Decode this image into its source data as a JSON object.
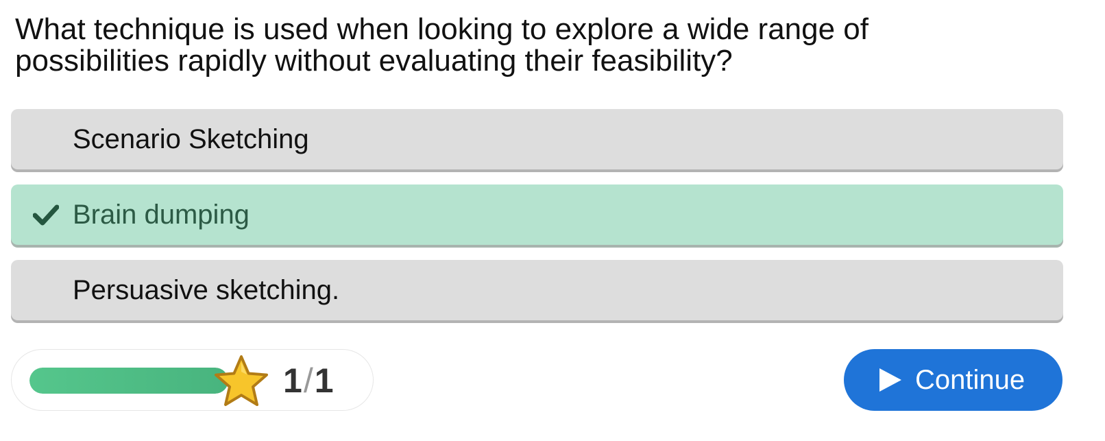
{
  "question": {
    "text": "What technique is used when looking to explore a wide range of possibilities rapidly without evaluating their feasibility?"
  },
  "options": [
    {
      "label": "Scenario Sketching",
      "state": "neutral"
    },
    {
      "label": "Brain dumping",
      "state": "correct",
      "icon": "check-icon"
    },
    {
      "label": "Persuasive sketching.",
      "state": "neutral"
    }
  ],
  "progress": {
    "fraction": 1.0,
    "current": "1",
    "separator": "/",
    "total": "1",
    "icon": "star-icon"
  },
  "continue_button": {
    "label": "Continue",
    "icon": "play-icon"
  },
  "colors": {
    "correct_bg": "#b5e3cf",
    "neutral_bg": "#dddddd",
    "accent_blue": "#1f74d8",
    "progress_green": "#55c68c",
    "star_gold": "#f7c52b"
  }
}
